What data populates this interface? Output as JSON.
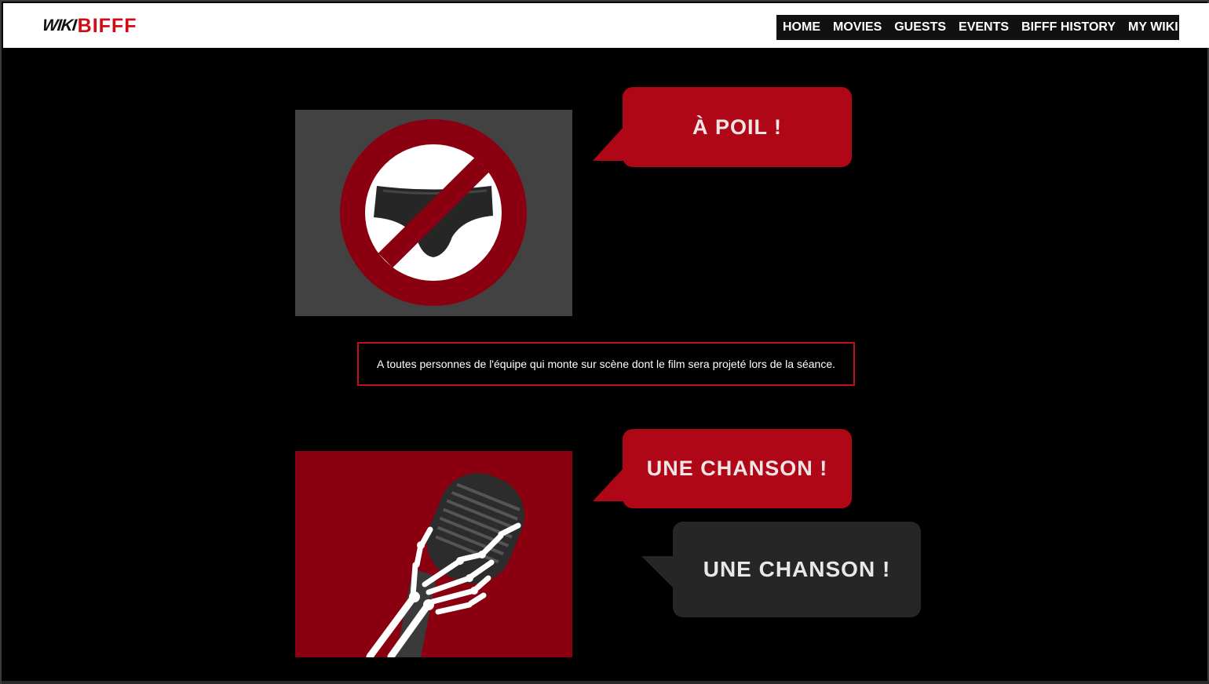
{
  "header": {
    "logo_wiki": "WIKI",
    "logo_bifff": "BIFFF"
  },
  "nav": {
    "items": [
      {
        "label": "HOME"
      },
      {
        "label": "MOVIES"
      },
      {
        "label": "GUESTS"
      },
      {
        "label": "EVENTS"
      },
      {
        "label": "BIFFF HISTORY"
      },
      {
        "label": "MY WIKI",
        "dropdown": true
      }
    ]
  },
  "section1": {
    "image_icon": "no-underwear-icon",
    "bubble": "À POIL !",
    "caption": "A toutes personnes de l'équipe qui monte sur scène dont le film sera projeté lors de la séance."
  },
  "section2": {
    "image_icon": "skeleton-hand-microphone-icon",
    "bubble_red": "UNE CHANSON !",
    "bubble_dark": "UNE CHANSON !"
  },
  "colors": {
    "accent_red": "#b00718",
    "panel_grey": "#424242",
    "panel_red": "#8b0010",
    "background": "#000000"
  }
}
